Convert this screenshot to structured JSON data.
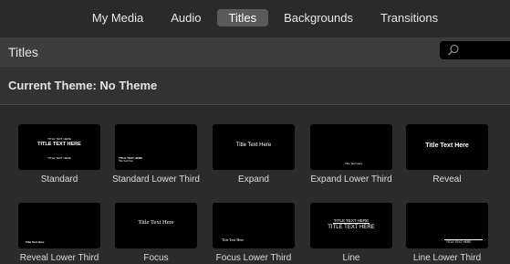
{
  "tabs": [
    {
      "label": "My Media",
      "active": false
    },
    {
      "label": "Audio",
      "active": false
    },
    {
      "label": "Titles",
      "active": true
    },
    {
      "label": "Backgrounds",
      "active": false
    },
    {
      "label": "Transitions",
      "active": false
    }
  ],
  "header": {
    "title": "Titles",
    "search_icon": "search-icon"
  },
  "theme": {
    "label": "Current Theme: No Theme"
  },
  "titles": [
    {
      "label": "Standard",
      "preview_top": "TITLE TEXT HERE",
      "preview_main": "TITLE TEXT HERE",
      "preview_sub": "TITLE TEXT HERE"
    },
    {
      "label": "Standard Lower Third",
      "preview_main": "TITLE TEXT HERE",
      "preview_sub": "Title Text Here"
    },
    {
      "label": "Expand",
      "preview_main": "Title Text Here"
    },
    {
      "label": "Expand Lower Third",
      "preview_main": "Title Text Here"
    },
    {
      "label": "Reveal",
      "preview_main": "Title Text Here"
    },
    {
      "label": "Reveal Lower Third",
      "preview_main": "Title Text Here"
    },
    {
      "label": "Focus",
      "preview_main": "Title Text Here"
    },
    {
      "label": "Focus Lower Third",
      "preview_main": "Title Text Here"
    },
    {
      "label": "Line",
      "preview_top": "TITLE TEXT HERE",
      "preview_main": "TITLE TEXT HERE"
    },
    {
      "label": "Line Lower Third",
      "preview_main": "TITLE TEXT HERE"
    }
  ]
}
